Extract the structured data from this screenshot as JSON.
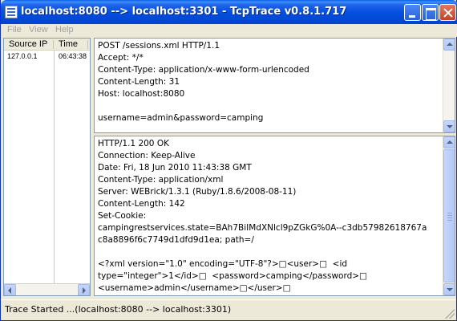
{
  "window": {
    "title": "localhost:8080 --> localhost:3301 - TcpTrace v0.8.1.717",
    "icon": "tcptrace-app-icon"
  },
  "controls": {
    "minimize": "minimize-button",
    "maximize": "maximize-button",
    "close": "close-button"
  },
  "menu": {
    "items": [
      {
        "label": "File"
      },
      {
        "label": "View"
      },
      {
        "label": "Help"
      }
    ]
  },
  "connections": {
    "columns": [
      "Source IP",
      "Time"
    ],
    "rows": [
      {
        "source_ip": "127.0.0.1",
        "time": "06:43:38"
      }
    ]
  },
  "request": {
    "text": "POST /sessions.xml HTTP/1.1\nAccept: */*\nContent-Type: application/x-www-form-urlencoded\nContent-Length: 31\nHost: localhost:8080\n\nusername=admin&password=camping"
  },
  "response": {
    "text": "HTTP/1.1 200 OK\nConnection: Keep-Alive\nDate: Fri, 18 Jun 2010 11:43:38 GMT\nContent-Type: application/xml\nServer: WEBrick/1.3.1 (Ruby/1.8.6/2008-08-11)\nContent-Length: 142\nSet-Cookie:\ncampingrestservices.state=BAh7BiIMdXNlcl9pZGkG%0A--c3db57982618767a\nc8a8896f6c7749d1dfd9d1ea; path=/\n\n<?xml version=\"1.0\" encoding=\"UTF-8\"?>□<user>□  <id\ntype=\"integer\">1</id>□  <password>camping</password>□\n<username>admin</username>□</user>□"
  },
  "status": {
    "text": "Trace Started ...(localhost:8080 --> localhost:3301)"
  }
}
